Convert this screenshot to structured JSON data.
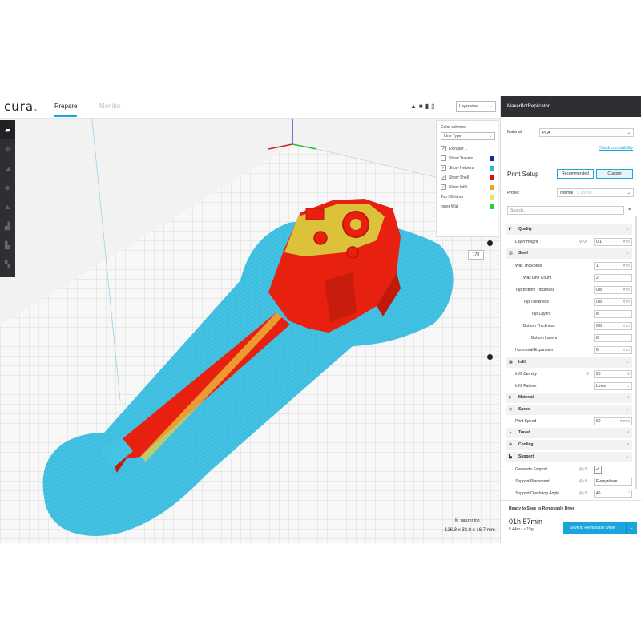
{
  "app": {
    "logo": "cura",
    "logo_dot": "."
  },
  "tabs": [
    {
      "label": "Prepare"
    },
    {
      "label": "Monitor"
    }
  ],
  "view_select": {
    "value": "Layer view"
  },
  "color_panel": {
    "header": "Color scheme",
    "scheme": "Line Type",
    "items": [
      {
        "label": "Extruder 1",
        "checked": true,
        "color": ""
      },
      {
        "label": "Show Travels",
        "checked": false,
        "color": "#1a2a9c"
      },
      {
        "label": "Show Helpers",
        "checked": true,
        "color": "#2ab6d6"
      },
      {
        "label": "Show Shell",
        "checked": true,
        "color": "#e01010"
      },
      {
        "label": "Show Infill",
        "checked": true,
        "color": "#e8a818"
      },
      {
        "label": "Top / Bottom",
        "checked": false,
        "color": "#e8e850"
      },
      {
        "label": "Inner Wall",
        "checked": false,
        "color": "#2ad040"
      }
    ]
  },
  "layer": {
    "value": "178"
  },
  "object": {
    "name": "M_panzer top",
    "dimensions": "126.3 x 33.8 x 16.7 mm"
  },
  "right_panel": {
    "printer": "MakerBotReplicator",
    "material_label": "Material",
    "material_value": "PLA",
    "check_compat": "Check compatibility",
    "print_setup": "Print Setup",
    "mode_recommended": "Recommended",
    "mode_custom": "Custom",
    "profile_label": "Profile:",
    "profile_value": "Normal",
    "profile_quality": "0.15mm",
    "search_placeholder": "Search...",
    "sections": {
      "quality": "Quality",
      "shell": "Shell",
      "infill": "Infill",
      "material": "Material",
      "speed": "Speed",
      "travel": "Travel",
      "cooling": "Cooling",
      "support": "Support"
    },
    "settings": {
      "layer_height": {
        "label": "Layer Height",
        "value": "0.1",
        "unit": "mm"
      },
      "wall_thickness": {
        "label": "Wall Thickness",
        "value": "1",
        "unit": "mm"
      },
      "wall_line_count": {
        "label": "Wall Line Count",
        "value": "2",
        "unit": ""
      },
      "top_bottom_thickness": {
        "label": "Top/Bottom Thickness",
        "value": "0.8",
        "unit": "mm"
      },
      "top_thickness": {
        "label": "Top Thickness",
        "value": "0.8",
        "unit": "mm"
      },
      "top_layers": {
        "label": "Top Layers",
        "value": "8",
        "unit": ""
      },
      "bottom_thickness": {
        "label": "Bottom Thickness",
        "value": "0.8",
        "unit": "mm"
      },
      "bottom_layers": {
        "label": "Bottom Layers",
        "value": "8",
        "unit": ""
      },
      "horizontal_expansion": {
        "label": "Horizontal Expansion",
        "value": "0",
        "unit": "mm"
      },
      "infill_density": {
        "label": "Infill Density",
        "value": "20",
        "unit": "%"
      },
      "infill_pattern": {
        "label": "Infill Pattern",
        "value": "Lines",
        "unit": ""
      },
      "print_speed": {
        "label": "Print Speed",
        "value": "60",
        "unit": "mm/s"
      },
      "generate_support": {
        "label": "Generate Support",
        "value": "✓",
        "unit": ""
      },
      "support_placement": {
        "label": "Support Placement",
        "value": "Everywhere",
        "unit": ""
      },
      "support_overhang": {
        "label": "Support Overhang Angle",
        "value": "45",
        "unit": "°"
      }
    },
    "ready_text": "Ready to Save to Removable Drive",
    "time": "01h 57min",
    "material_estimate": "5.44m / ~ 15g",
    "save_button": "Save to Removable Drive"
  }
}
